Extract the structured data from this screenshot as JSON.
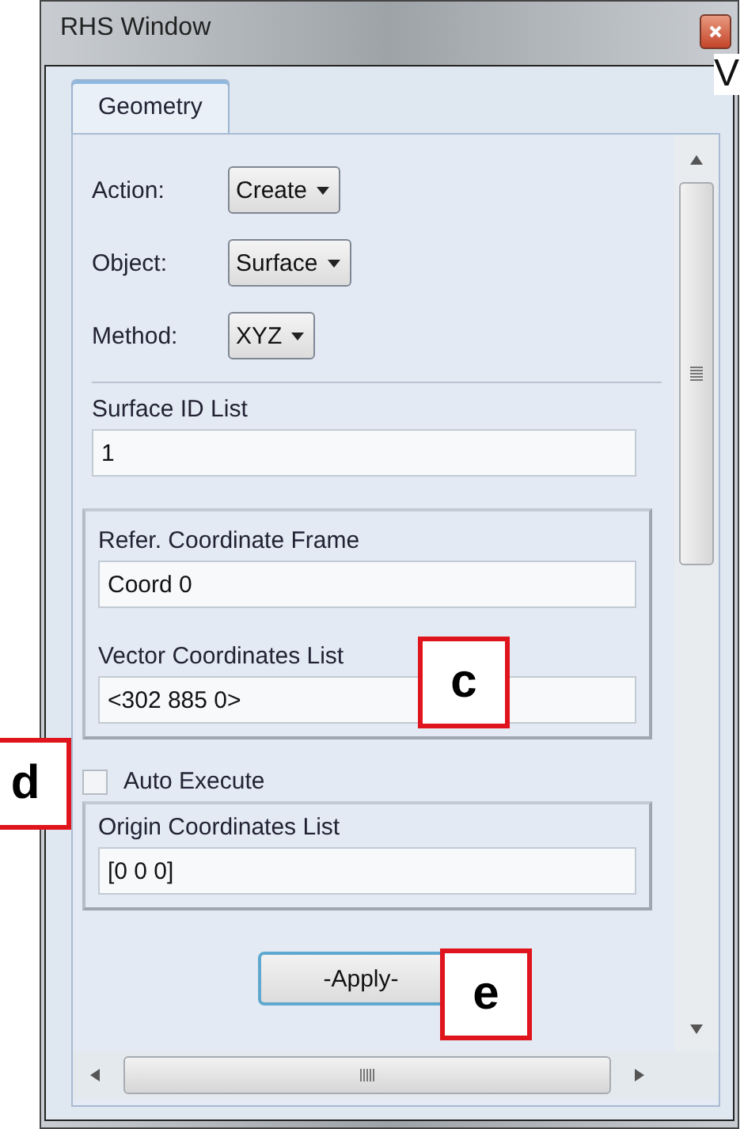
{
  "window": {
    "title": "RHS Window"
  },
  "tabs": [
    {
      "label": "Geometry",
      "selected": true
    }
  ],
  "selectors": [
    {
      "label": "Action:",
      "value": "Create"
    },
    {
      "label": "Object:",
      "value": "Surface"
    },
    {
      "label": "Method:",
      "value": "XYZ"
    }
  ],
  "id_list": {
    "label": "Surface ID List",
    "value": "1"
  },
  "frame_group": {
    "fields": [
      {
        "label": "Refer. Coordinate Frame",
        "value": "Coord 0"
      },
      {
        "label": "Vector Coordinates List",
        "value": "<302 885 0>"
      }
    ]
  },
  "auto_execute": {
    "label": "Auto Execute",
    "checked": false
  },
  "origin_group": {
    "fields": [
      {
        "label": "Origin Coordinates List",
        "value": "[0 0 0]"
      }
    ]
  },
  "apply_button": "-Apply-",
  "callouts": [
    {
      "label": "c"
    },
    {
      "label": "d"
    },
    {
      "label": "e"
    }
  ],
  "edge_text": "V"
}
